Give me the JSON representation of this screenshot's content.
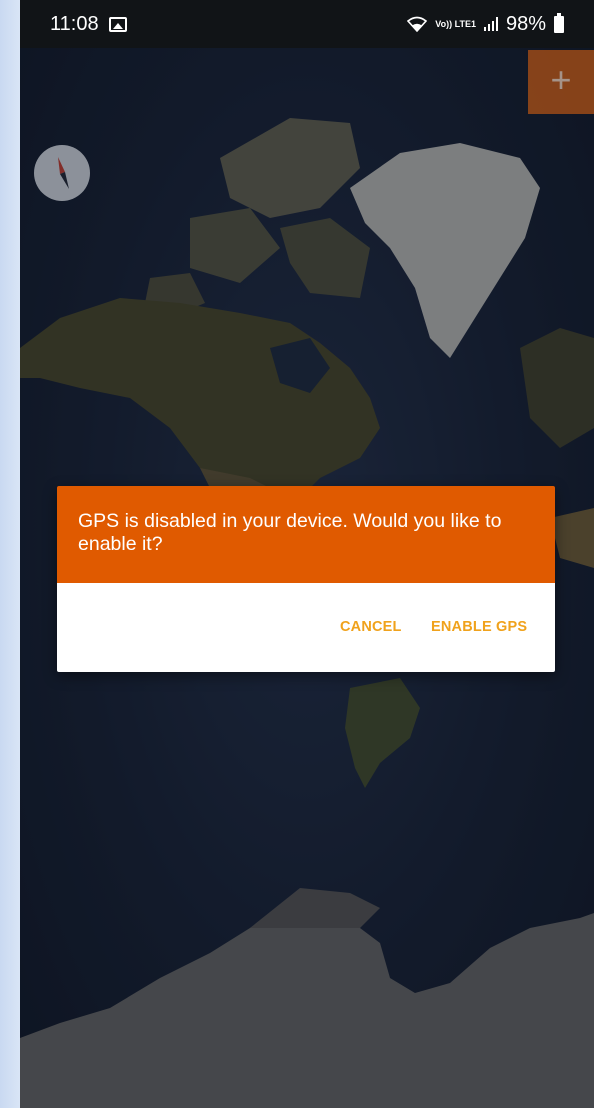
{
  "status_bar": {
    "time": "11:08",
    "notification_icon": "gallery-icon",
    "volte_label": "Vo)) LTE1",
    "battery": "98%"
  },
  "map": {
    "zoom_in_label": "+",
    "compass_icon": "compass-icon"
  },
  "dialog": {
    "message": "GPS is disabled in your device. Would you like to enable it?",
    "cancel_label": "CANCEL",
    "enable_label": "ENABLE GPS"
  },
  "colors": {
    "dialog_header": "#e05a00",
    "dialog_button_text": "#f0a21c",
    "zoom_button": "#c65a14"
  }
}
